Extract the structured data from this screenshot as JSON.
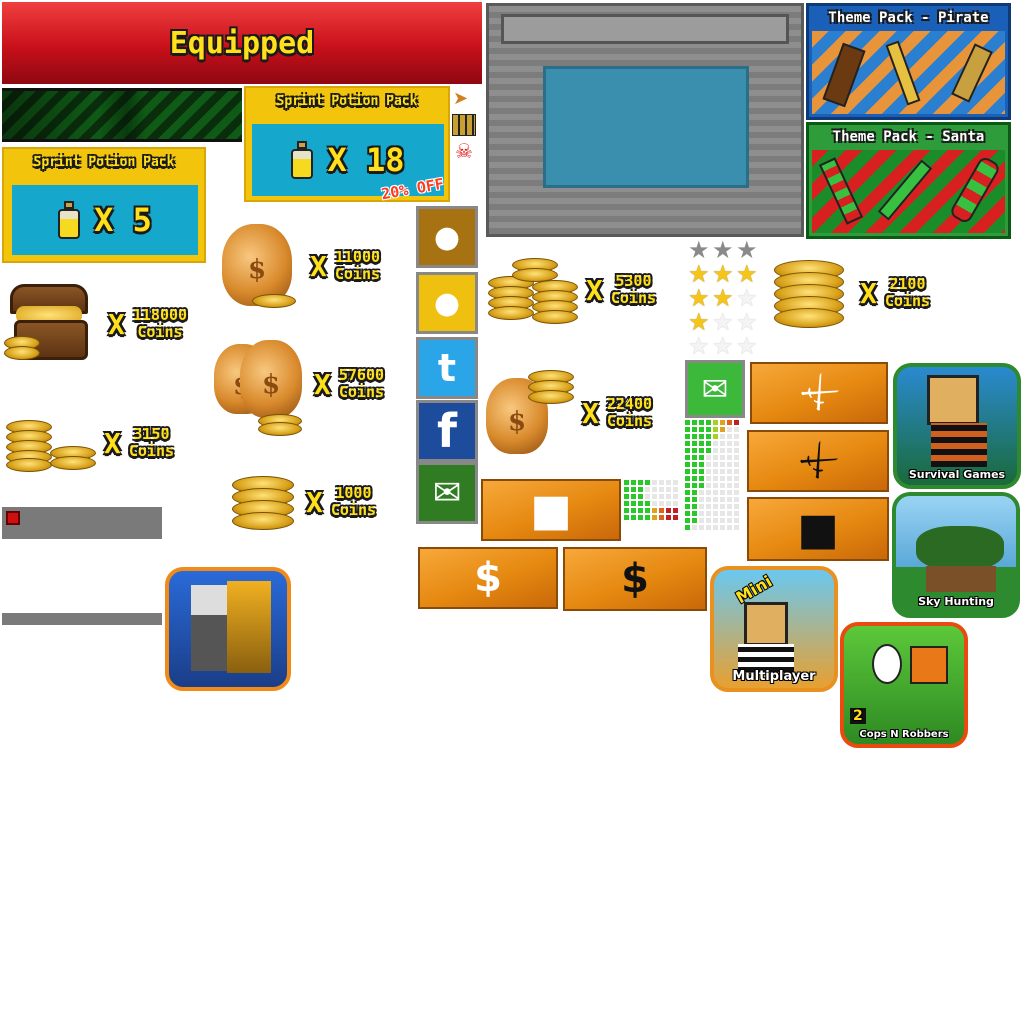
{
  "equipped": {
    "label": "Equipped"
  },
  "potion_small": {
    "title": "Sprint Potion Pack",
    "qty": "X 5"
  },
  "potion_large": {
    "title": "Sprint Potion Pack",
    "qty": "X 18",
    "discount": "20% OFF"
  },
  "theme_pirate": {
    "title": "Theme Pack - Pirate"
  },
  "theme_santa": {
    "title": "Theme Pack - Santa"
  },
  "offers": {
    "x": "X",
    "coins_label": "Coins",
    "o11000": "11000",
    "o118000": "118000",
    "o57600": "57600",
    "o3150": "3150",
    "o1000": "1000",
    "o5300": "5300",
    "o2100": "2100",
    "o22400": "22400"
  },
  "social": {
    "twitter_glyph": "t",
    "facebook_glyph": "f"
  },
  "shop": {
    "dollar": "$"
  },
  "apps": {
    "survival": "Survival Games",
    "sky": "Sky Hunting",
    "mini_top": "Mini",
    "mini_bottom": "Multiplayer",
    "cops": "Cops N Robbers",
    "cops_badge": "2"
  },
  "ratings": {
    "rows": [
      0,
      3,
      2,
      1,
      0
    ],
    "max": 3
  },
  "colors": {
    "accent_yellow": "#ffe01a",
    "banner_red": "#c8101a",
    "potion_blue": "#15a7cc",
    "orange": "#e58810"
  }
}
